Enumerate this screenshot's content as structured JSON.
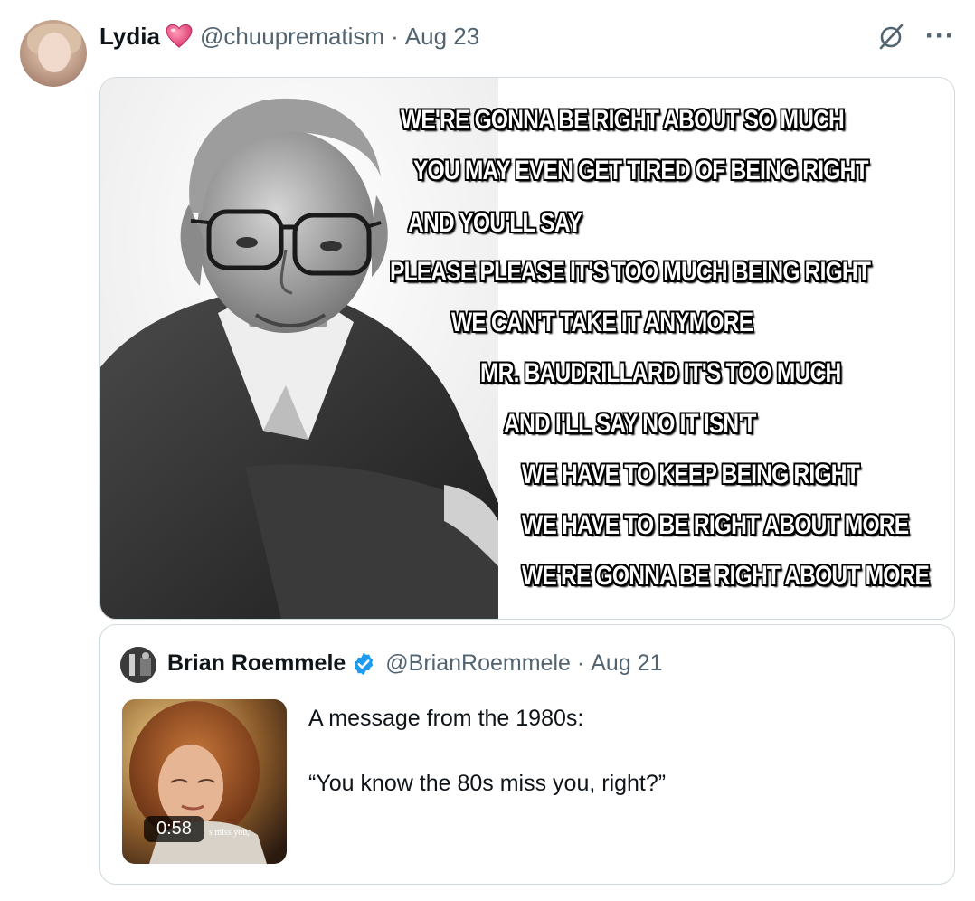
{
  "tweet": {
    "author_name": "Lydia",
    "handle": "@chuuprematism",
    "separator": "·",
    "date": "Aug 23",
    "more_label": "···",
    "image_lines": [
      "WE'RE GONNA BE RIGHT ABOUT SO MUCH",
      "YOU MAY EVEN GET TIRED OF BEING RIGHT",
      "AND YOU'LL SAY",
      "PLEASE PLEASE IT'S TOO MUCH BEING RIGHT",
      "WE CAN'T TAKE IT ANYMORE",
      "MR. BAUDRILLARD IT'S TOO MUCH",
      "AND I'LL SAY NO IT ISN'T",
      "WE HAVE TO KEEP BEING RIGHT",
      "WE HAVE TO BE RIGHT ABOUT MORE",
      "WE'RE GONNA BE RIGHT ABOUT MORE"
    ]
  },
  "quoted": {
    "author_name": "Brian Roemmele",
    "handle": "@BrianRoemmele",
    "separator": "·",
    "date": "Aug 21",
    "text_line_1": "A message from the 1980s:",
    "text_line_2": "“You know the 80s miss you, right?”",
    "video_duration": "0:58",
    "thumb_caption": "s miss you,"
  },
  "colors": {
    "muted": "#536471",
    "border": "#cfd9de",
    "verified": "#1d9bf0",
    "heart": "#e0457b"
  },
  "icons": [
    "heart-emoji-icon",
    "grok-icon",
    "more-icon",
    "verified-badge-icon"
  ]
}
